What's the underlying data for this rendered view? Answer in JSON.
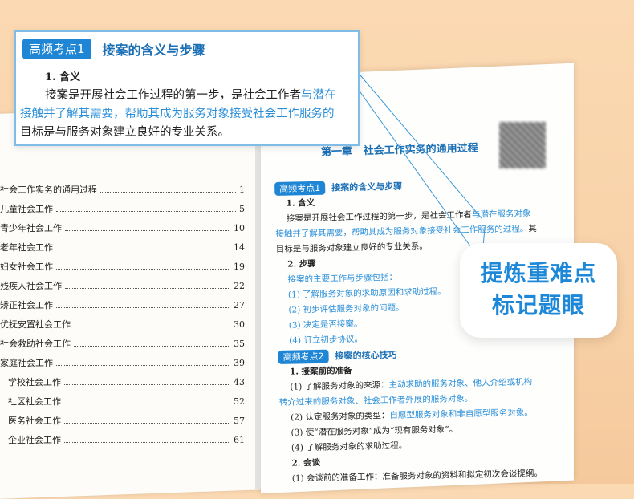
{
  "colors": {
    "accent": "#1f86d6",
    "highlight_text": "#2b8fd8",
    "background": "#f8d2a8"
  },
  "popup": {
    "badge": "高频考点1",
    "title": "接案的含义与步骤",
    "sub": "1. 含义",
    "line1_a": "接案是开展社会工作过程的第一步，是社会工作者",
    "line1_b": "与潜在",
    "line2": "接触并了解其需要，帮助其成为服务对象接受社会工作服务的",
    "line3": "目标是与服务对象建立良好的专业关系。"
  },
  "toc": [
    {
      "title": "社会工作实务的通用过程",
      "page": "1"
    },
    {
      "title": "儿童社会工作",
      "page": "5"
    },
    {
      "title": "青少年社会工作",
      "page": "10"
    },
    {
      "title": "老年社会工作",
      "page": "14"
    },
    {
      "title": "妇女社会工作",
      "page": "19"
    },
    {
      "title": "残疾人社会工作",
      "page": "22"
    },
    {
      "title": "矫正社会工作",
      "page": "27"
    },
    {
      "title": "优抚安置社会工作",
      "page": "30"
    },
    {
      "title": "社会救助社会工作",
      "page": "35"
    },
    {
      "title": "家庭社会工作",
      "page": "39"
    },
    {
      "title": "学校社会工作",
      "page": "43"
    },
    {
      "title": "社区社会工作",
      "page": "52"
    },
    {
      "title": "医务社会工作",
      "page": "57"
    },
    {
      "title": "企业社会工作",
      "page": "61"
    }
  ],
  "chapter": {
    "number": "第一章",
    "title": "社会工作实务的通用过程"
  },
  "page": {
    "s1_badge": "高频考点1",
    "s1_title": "接案的含义与步骤",
    "h1": "1. 含义",
    "p1_a": "接案是开展社会工作过程的第一步，是社会工作者",
    "p1_b": "与潜在服务对象",
    "p2_a": "接触并了解其需要，帮助其成为服务对象接受社会工作服务的过程。",
    "p2_b": "其",
    "p3": "目标是与服务对象建立良好的专业关系。",
    "h2": "2. 步骤",
    "steps_intro": "接案的主要工作与步骤包括：",
    "step1": "(1) 了解服务对象的求助原因和求助过程。",
    "step2": "(2) 初步评估服务对象的问题。",
    "step3": "(3) 决定是否接案。",
    "step4": "(4) 订立初步协议。",
    "s2_badge": "高频考点2",
    "s2_title": "接案的核心技巧",
    "h3": "1. 接案前的准备",
    "c1_a": "(1) 了解服务对象的来源：",
    "c1_b": "主动求助的服务对象、他人介绍或机构",
    "c1_c": "转介过来的服务对象、社会工作者外展的服务对象。",
    "c2_a": "(2) 认定服务对象的类型：",
    "c2_b": "自愿型服务对象和非自愿型服务对象。",
    "c3": "(3) 使“潜在服务对象”成为“现有服务对象”。",
    "c4": "(4) 了解服务对象的求助过程。",
    "h4": "2. 会谈",
    "d1": "(1) 会谈前的准备工作：准备服务对象的资料和拟定初次会谈提纲。"
  },
  "label": {
    "line1": "提炼重难点",
    "line2": "标记题眼"
  }
}
